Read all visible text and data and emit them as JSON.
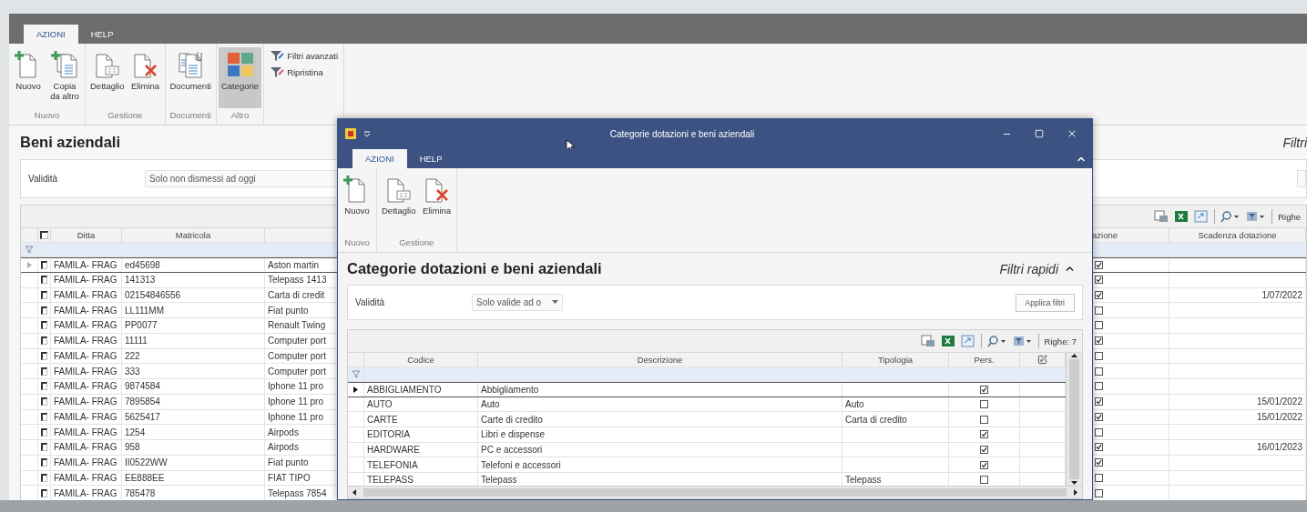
{
  "main_window": {
    "tabs": [
      {
        "label": "AZIONI",
        "selected": true
      },
      {
        "label": "HELP",
        "selected": false
      }
    ],
    "ribbon_groups": [
      {
        "label": "Nuovo",
        "buttons": [
          {
            "label": "Nuovo",
            "selected": false
          },
          {
            "label": "Copia da altro",
            "selected": false
          }
        ]
      },
      {
        "label": "Gestione",
        "buttons": [
          {
            "label": "Dettaglio",
            "selected": false
          },
          {
            "label": "Elimina",
            "selected": false
          }
        ]
      },
      {
        "label": "Documenti",
        "buttons": [
          {
            "label": "Documenti",
            "selected": false
          }
        ]
      },
      {
        "label": "Altro",
        "buttons": [
          {
            "label": "Categorie",
            "selected": true
          }
        ]
      }
    ],
    "filter_buttons": [
      "Filtri avanzati",
      "Ripristina"
    ],
    "title": "Beni aziendali",
    "quick_filters_label": "Filtri",
    "filters": [
      {
        "label": "Validità",
        "value": "Solo non dismessi ad oggi"
      }
    ],
    "grid": {
      "rows_label": "Righe",
      "header_checked": false,
      "columns": [
        "Ditta",
        "Matricola",
        "azione",
        "Scadenza dotazione"
      ],
      "rows": [
        {
          "current": true,
          "checked": false,
          "ditta": "FAMILA- FRAG",
          "matricola": "ed45698",
          "column_3": "Aston martin",
          "column_4_checked": true
        },
        {
          "current": false,
          "checked": false,
          "ditta": "FAMILA- FRAG",
          "matricola": "141313",
          "column_3": "Telepass 1413",
          "column_4_checked": true
        },
        {
          "current": false,
          "checked": false,
          "ditta": "FAMILA- FRAG",
          "matricola": "02154846556",
          "column_3": "Carta di credit",
          "column_4_checked": true,
          "scadenza": "1/07/2022"
        },
        {
          "current": false,
          "checked": false,
          "ditta": "FAMILA- FRAG",
          "matricola": "LL111MM",
          "column_3": "Fiat punto",
          "column_4_checked": false
        },
        {
          "current": false,
          "checked": false,
          "ditta": "FAMILA- FRAG",
          "matricola": "PP0077",
          "column_3": "Renault Twing",
          "column_4_checked": false
        },
        {
          "current": false,
          "checked": false,
          "ditta": "FAMILA- FRAG",
          "matricola": "11111",
          "column_3": "Computer port",
          "column_4_checked": true
        },
        {
          "current": false,
          "checked": false,
          "ditta": "FAMILA- FRAG",
          "matricola": "222",
          "column_3": "Computer port",
          "column_4_checked": false
        },
        {
          "current": false,
          "checked": false,
          "ditta": "FAMILA- FRAG",
          "matricola": "333",
          "column_3": "Computer port",
          "column_4_checked": false
        },
        {
          "current": false,
          "checked": false,
          "ditta": "FAMILA- FRAG",
          "matricola": "9874584",
          "column_3": "Iphone 11 pro",
          "column_4_checked": false
        },
        {
          "current": false,
          "checked": false,
          "ditta": "FAMILA- FRAG",
          "matricola": "7895854",
          "column_3": "Iphone 11 pro",
          "column_4_checked": true,
          "scadenza": "15/01/2022"
        },
        {
          "current": false,
          "checked": false,
          "ditta": "FAMILA- FRAG",
          "matricola": "5625417",
          "column_3": "Iphone 11 pro",
          "column_4_checked": true,
          "scadenza": "15/01/2022"
        },
        {
          "current": false,
          "checked": false,
          "ditta": "FAMILA- FRAG",
          "matricola": "1254",
          "column_3": "Airpods",
          "column_4_checked": false
        },
        {
          "current": false,
          "checked": false,
          "ditta": "FAMILA- FRAG",
          "matricola": "958",
          "column_3": "Airpods",
          "column_4_checked": true,
          "scadenza": "16/01/2023"
        },
        {
          "current": false,
          "checked": false,
          "ditta": "FAMILA- FRAG",
          "matricola": "II0522WW",
          "column_3": "Fiat punto",
          "column_4_checked": true
        },
        {
          "current": false,
          "checked": false,
          "ditta": "FAMILA- FRAG",
          "matricola": "EE888EE",
          "column_3": "FIAT TIPO",
          "column_4_checked": false
        },
        {
          "current": false,
          "checked": false,
          "ditta": "FAMILA- FRAG",
          "matricola": "785478",
          "column_3": "Telepass 7854",
          "column_4_checked": false
        }
      ]
    }
  },
  "dialog": {
    "title": "Categorie dotazioni e beni aziendali",
    "tabs": [
      {
        "label": "AZIONI",
        "selected": true
      },
      {
        "label": "HELP",
        "selected": false
      }
    ],
    "ribbon_groups": [
      {
        "label": "Nuovo",
        "buttons": [
          {
            "label": "Nuovo"
          }
        ]
      },
      {
        "label": "Gestione",
        "buttons": [
          {
            "label": "Dettaglio"
          },
          {
            "label": "Elimina"
          }
        ]
      }
    ],
    "heading": "Categorie dotazioni e beni aziendali",
    "quick_filters_label": "Filtri rapidi",
    "filters": [
      {
        "label": "Validità",
        "value": "Solo valide ad o"
      }
    ],
    "apply_button": "Applica filtri",
    "grid": {
      "rows_label": "Righe: 7",
      "columns": [
        "Codice",
        "Descrizione",
        "Tipologia",
        "Pers."
      ],
      "rows": [
        {
          "current": true,
          "codice": "ABBIGLIAMENTO",
          "descrizione": "Abbigliamento",
          "pers": true
        },
        {
          "current": false,
          "codice": "AUTO",
          "descrizione": "Auto",
          "tipologia": "Auto",
          "pers": false
        },
        {
          "current": false,
          "codice": "CARTE",
          "descrizione": "Carte di credito",
          "tipologia": "Carta di credito",
          "pers": false
        },
        {
          "current": false,
          "codice": "EDITORIA",
          "descrizione": "Libri e dispense",
          "pers": true
        },
        {
          "current": false,
          "codice": "HARDWARE",
          "descrizione": "PC e accessori",
          "pers": true
        },
        {
          "current": false,
          "codice": "TELEFONIA",
          "descrizione": "Telefoni e accessori",
          "pers": true
        },
        {
          "current": false,
          "codice": "TELEPASS",
          "descrizione": "Telepass",
          "tipologia": "Telepass",
          "pers": false
        }
      ]
    }
  }
}
